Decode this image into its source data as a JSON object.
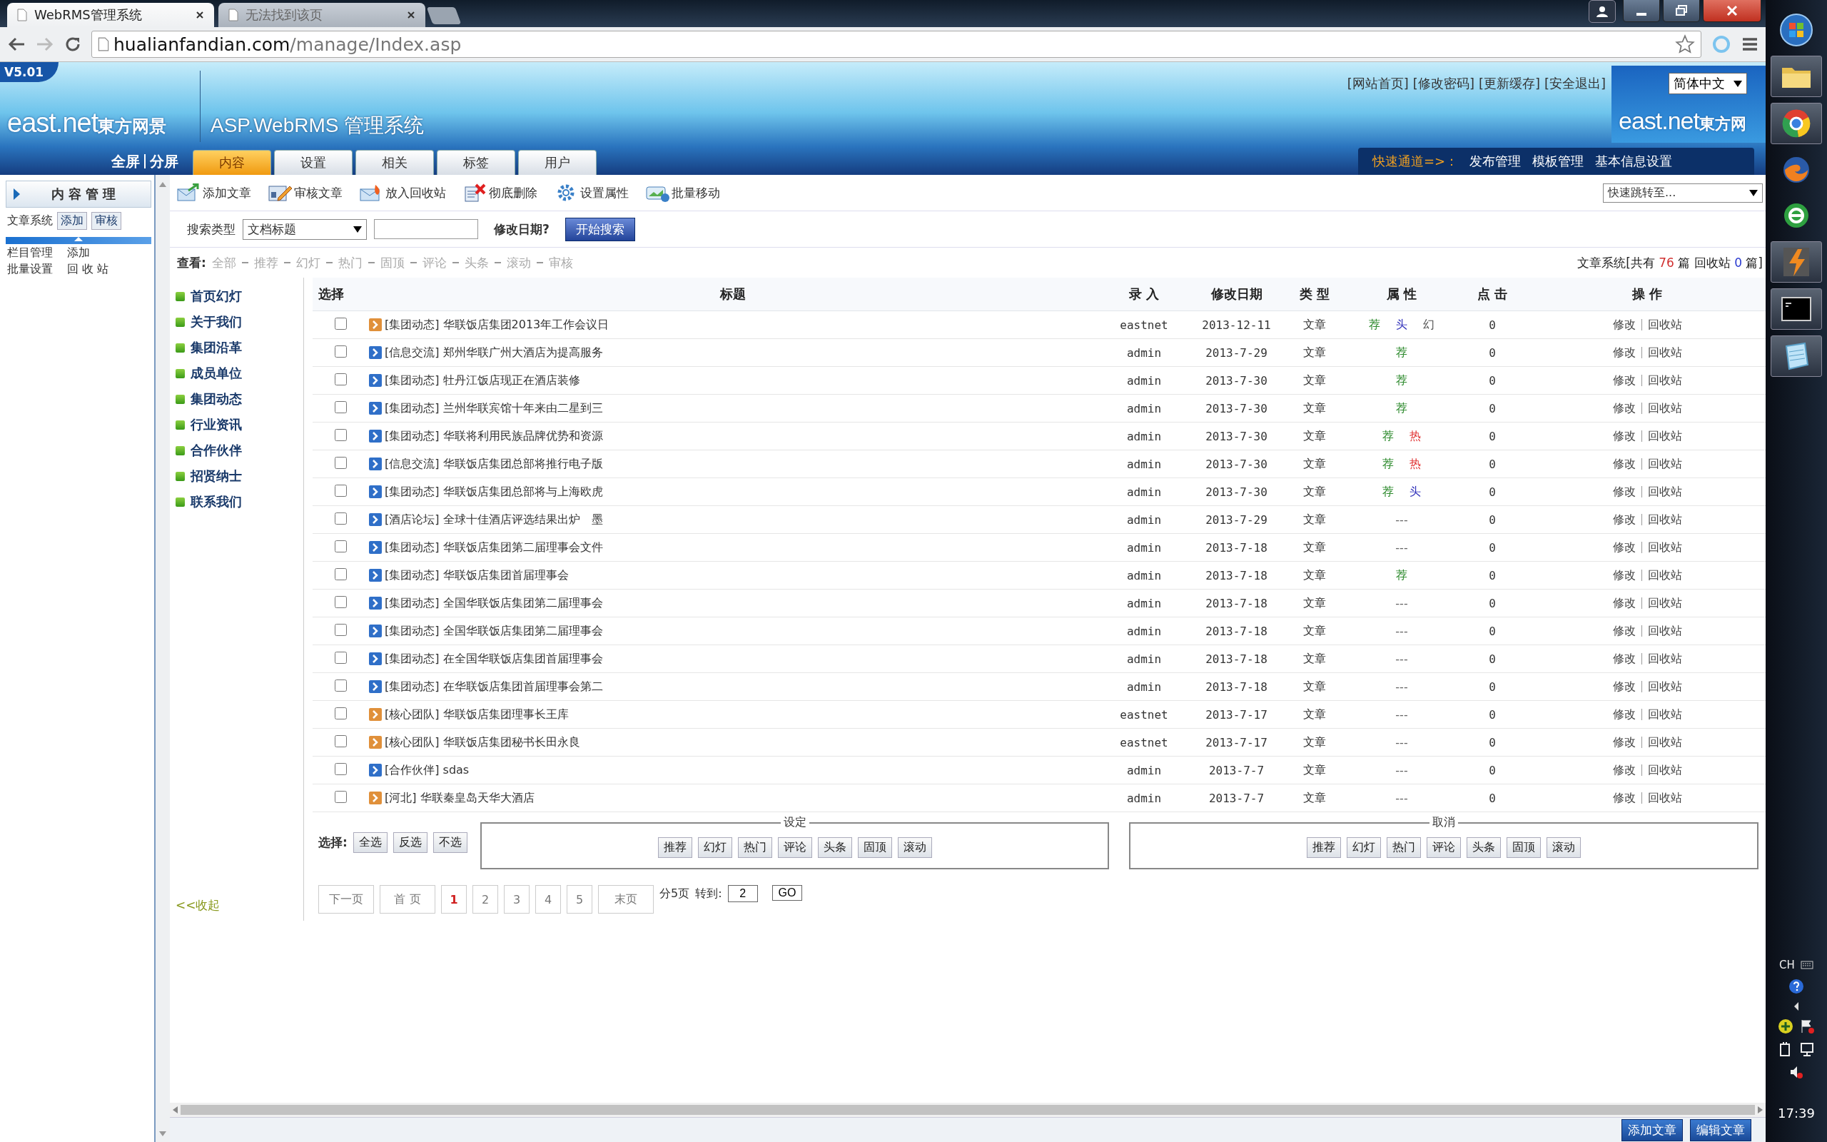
{
  "browser": {
    "tabs": [
      {
        "title": "WebRMS管理系统",
        "selected": true
      },
      {
        "title": "无法找到该页",
        "selected": false
      }
    ],
    "address": {
      "host": "hualianfandian.com",
      "path": "/manage/Index.asp"
    }
  },
  "header": {
    "version": "V5.01",
    "logo": "east.net",
    "logo_cn": "東方网景",
    "system_title": "ASP.WebRMS 管理系统",
    "view_links": [
      "全屏",
      "分屏"
    ],
    "nav_tabs": [
      {
        "label": "内容",
        "selected": true
      },
      {
        "label": "设置",
        "selected": false
      },
      {
        "label": "相关",
        "selected": false
      },
      {
        "label": "标签",
        "selected": false
      },
      {
        "label": "用户",
        "selected": false
      }
    ],
    "top_links": [
      "[网站首页]",
      "[修改密码]",
      "[更新缓存]",
      "[安全退出]"
    ],
    "language": "简体中文",
    "right_logo": "east.net",
    "right_logo_cn": "東方网",
    "quick_label": "快速通道=>：",
    "quick_links": [
      "发布管理",
      "模板管理",
      "基本信息设置"
    ]
  },
  "left_panel": {
    "title": "内容管理",
    "article": {
      "label": "文章系统",
      "buttons": [
        "添加",
        "审核"
      ]
    },
    "links": [
      {
        "label": "栏目管理",
        "action": "添加"
      },
      {
        "label": "批量设置",
        "action": "回 收 站"
      }
    ]
  },
  "toolbar": [
    {
      "label": "添加文章",
      "kind": "add"
    },
    {
      "label": "审核文章",
      "kind": "review"
    },
    {
      "label": "放入回收站",
      "kind": "recycle"
    },
    {
      "label": "彻底删除",
      "kind": "delete"
    },
    {
      "label": "设置属性",
      "kind": "settings"
    },
    {
      "label": "批量移动",
      "kind": "move"
    }
  ],
  "jump_select": "快速跳转至...",
  "search": {
    "label": "搜索类型",
    "type": "文档标题",
    "date_label": "修改日期?",
    "button": "开始搜索"
  },
  "view": {
    "label": "查看:",
    "filters": [
      "全部",
      "推荐",
      "幻灯",
      "热门",
      "固顶",
      "评论",
      "头条",
      "滚动",
      "审核"
    ]
  },
  "summary": {
    "prefix": "文章系统[共有",
    "total": "76",
    "mid": "篇 回收站",
    "recycled": "0",
    "suffix": "篇]"
  },
  "categories": [
    "首页幻灯",
    "关于我们",
    "集团沿革",
    "成员单位",
    "集团动态",
    "行业资讯",
    "合作伙伴",
    "招贤纳士",
    "联系我们"
  ],
  "collapse": "<<收起",
  "table": {
    "columns": [
      "选择",
      "标题",
      "录 入",
      "修改日期",
      "类 型",
      "属 性",
      "点 击",
      "操 作"
    ],
    "rows": [
      {
        "checked": false,
        "color": "#e0903a",
        "title": "[集团动态] 华联饭店集团2013年工作会议日",
        "author": "eastnet",
        "date": "2013-12-11",
        "type": "文章",
        "attrs": [
          {
            "text": "荐",
            "kind": "recommend"
          },
          {
            "text": "头",
            "kind": "headline"
          },
          {
            "text": "幻",
            "kind": "slide"
          }
        ],
        "clicks": "0",
        "edit": "修改",
        "recycle": "回收站"
      },
      {
        "checked": false,
        "color": "#2f6fc8",
        "title": "[信息交流] 郑州华联广州大酒店为提高服务",
        "author": "admin",
        "date": "2013-7-29",
        "type": "文章",
        "attrs": [
          {
            "text": "荐",
            "kind": "recommend"
          }
        ],
        "clicks": "0",
        "edit": "修改",
        "recycle": "回收站"
      },
      {
        "checked": false,
        "color": "#2f6fc8",
        "title": "[集团动态] 牡丹江饭店现正在酒店装修",
        "author": "admin",
        "date": "2013-7-30",
        "type": "文章",
        "attrs": [
          {
            "text": "荐",
            "kind": "recommend"
          }
        ],
        "clicks": "0",
        "edit": "修改",
        "recycle": "回收站"
      },
      {
        "checked": false,
        "color": "#2f6fc8",
        "title": "[集团动态] 兰州华联宾馆十年来由二星到三",
        "author": "admin",
        "date": "2013-7-30",
        "type": "文章",
        "attrs": [
          {
            "text": "荐",
            "kind": "recommend"
          }
        ],
        "clicks": "0",
        "edit": "修改",
        "recycle": "回收站"
      },
      {
        "checked": false,
        "color": "#2f6fc8",
        "title": "[集团动态] 华联将利用民族品牌优势和资源",
        "author": "admin",
        "date": "2013-7-30",
        "type": "文章",
        "attrs": [
          {
            "text": "荐",
            "kind": "recommend"
          },
          {
            "text": "热",
            "kind": "hot"
          }
        ],
        "clicks": "0",
        "edit": "修改",
        "recycle": "回收站"
      },
      {
        "checked": false,
        "color": "#2f6fc8",
        "title": "[信息交流] 华联饭店集团总部将推行电子版",
        "author": "admin",
        "date": "2013-7-30",
        "type": "文章",
        "attrs": [
          {
            "text": "荐",
            "kind": "recommend"
          },
          {
            "text": "热",
            "kind": "hot"
          }
        ],
        "clicks": "0",
        "edit": "修改",
        "recycle": "回收站"
      },
      {
        "checked": false,
        "color": "#2f6fc8",
        "title": "[集团动态] 华联饭店集团总部将与上海欧虎",
        "author": "admin",
        "date": "2013-7-30",
        "type": "文章",
        "attrs": [
          {
            "text": "荐",
            "kind": "recommend"
          },
          {
            "text": "头",
            "kind": "headline"
          }
        ],
        "clicks": "0",
        "edit": "修改",
        "recycle": "回收站"
      },
      {
        "checked": false,
        "color": "#2f6fc8",
        "title": "[酒店论坛] 全球十佳酒店评选结果出炉　墨",
        "author": "admin",
        "date": "2013-7-29",
        "type": "文章",
        "attrs": [
          {
            "text": "---",
            "kind": "none"
          }
        ],
        "clicks": "0",
        "edit": "修改",
        "recycle": "回收站"
      },
      {
        "checked": false,
        "color": "#2f6fc8",
        "title": "[集团动态] 华联饭店集团第二届理事会文件",
        "author": "admin",
        "date": "2013-7-18",
        "type": "文章",
        "attrs": [
          {
            "text": "---",
            "kind": "none"
          }
        ],
        "clicks": "0",
        "edit": "修改",
        "recycle": "回收站"
      },
      {
        "checked": false,
        "color": "#2f6fc8",
        "title": "[集团动态] 华联饭店集团首届理事会",
        "author": "admin",
        "date": "2013-7-18",
        "type": "文章",
        "attrs": [
          {
            "text": "荐",
            "kind": "recommend"
          }
        ],
        "clicks": "0",
        "edit": "修改",
        "recycle": "回收站"
      },
      {
        "checked": false,
        "color": "#2f6fc8",
        "title": "[集团动态] 全国华联饭店集团第二届理事会",
        "author": "admin",
        "date": "2013-7-18",
        "type": "文章",
        "attrs": [
          {
            "text": "---",
            "kind": "none"
          }
        ],
        "clicks": "0",
        "edit": "修改",
        "recycle": "回收站"
      },
      {
        "checked": false,
        "color": "#2f6fc8",
        "title": "[集团动态] 全国华联饭店集团第二届理事会",
        "author": "admin",
        "date": "2013-7-18",
        "type": "文章",
        "attrs": [
          {
            "text": "---",
            "kind": "none"
          }
        ],
        "clicks": "0",
        "edit": "修改",
        "recycle": "回收站"
      },
      {
        "checked": false,
        "color": "#2f6fc8",
        "title": "[集团动态] 在全国华联饭店集团首届理事会",
        "author": "admin",
        "date": "2013-7-18",
        "type": "文章",
        "attrs": [
          {
            "text": "---",
            "kind": "none"
          }
        ],
        "clicks": "0",
        "edit": "修改",
        "recycle": "回收站"
      },
      {
        "checked": false,
        "color": "#2f6fc8",
        "title": "[集团动态] 在华联饭店集团首届理事会第二",
        "author": "admin",
        "date": "2013-7-18",
        "type": "文章",
        "attrs": [
          {
            "text": "---",
            "kind": "none"
          }
        ],
        "clicks": "0",
        "edit": "修改",
        "recycle": "回收站"
      },
      {
        "checked": false,
        "color": "#e0903a",
        "title": "[核心团队] 华联饭店集团理事长王库",
        "author": "eastnet",
        "date": "2013-7-17",
        "type": "文章",
        "attrs": [
          {
            "text": "---",
            "kind": "none"
          }
        ],
        "clicks": "0",
        "edit": "修改",
        "recycle": "回收站"
      },
      {
        "checked": false,
        "color": "#e0903a",
        "title": "[核心团队] 华联饭店集团秘书长田永良",
        "author": "eastnet",
        "date": "2013-7-17",
        "type": "文章",
        "attrs": [
          {
            "text": "---",
            "kind": "none"
          }
        ],
        "clicks": "0",
        "edit": "修改",
        "recycle": "回收站"
      },
      {
        "checked": false,
        "color": "#2f6fc8",
        "title": "[合作伙伴] sdas",
        "author": "admin",
        "date": "2013-7-7",
        "type": "文章",
        "attrs": [
          {
            "text": "---",
            "kind": "none"
          }
        ],
        "clicks": "0",
        "edit": "修改",
        "recycle": "回收站"
      },
      {
        "checked": false,
        "color": "#e0903a",
        "title": "[河北] 华联秦皇岛天华大酒店",
        "author": "admin",
        "date": "2013-7-7",
        "type": "文章",
        "attrs": [
          {
            "text": "---",
            "kind": "none"
          }
        ],
        "clicks": "0",
        "edit": "修改",
        "recycle": "回收站"
      }
    ]
  },
  "bulk": {
    "select_label": "选择:",
    "select_buttons": [
      "全选",
      "反选",
      "不选"
    ],
    "groups": [
      {
        "legend": "设定",
        "buttons": [
          "推荐",
          "幻灯",
          "热门",
          "评论",
          "头条",
          "固顶",
          "滚动"
        ]
      },
      {
        "legend": "取消",
        "buttons": [
          "推荐",
          "幻灯",
          "热门",
          "评论",
          "头条",
          "固顶",
          "滚动"
        ]
      }
    ]
  },
  "pagination": {
    "items": [
      {
        "label": "下一页",
        "kind": "nav",
        "selected": false
      },
      {
        "label": "首 页",
        "kind": "nav",
        "selected": false
      },
      {
        "label": "1",
        "kind": "page",
        "selected": true
      },
      {
        "label": "2",
        "kind": "page",
        "selected": false
      },
      {
        "label": "3",
        "kind": "page",
        "selected": false
      },
      {
        "label": "4",
        "kind": "page",
        "selected": false
      },
      {
        "label": "5",
        "kind": "page",
        "selected": false
      },
      {
        "label": "末页",
        "kind": "nav",
        "selected": false
      }
    ],
    "total": "分5页",
    "goto_label": "转到:",
    "goto_value": "2",
    "go": "GO"
  },
  "status_buttons": [
    "添加文章",
    "编辑文章"
  ],
  "taskbar": {
    "lang": "CH",
    "time": "17:39"
  }
}
